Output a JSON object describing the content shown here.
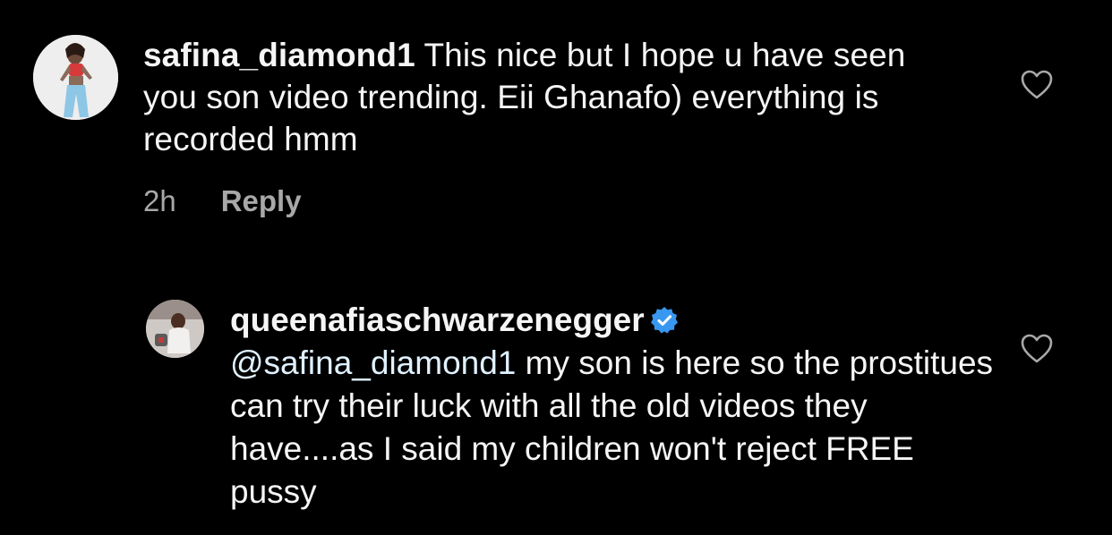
{
  "comments": [
    {
      "username": "safina_diamond1",
      "text": "This nice but I hope u have seen you son video trending. Eii Ghanafo) everything is recorded hmm",
      "time": "2h",
      "reply_label": "Reply",
      "avatar_icon": "profile-photo",
      "like_icon": "heart-outline-icon"
    },
    {
      "username": "queenafiaschwarzenegger",
      "verified": true,
      "mention": "@safina_diamond1",
      "text": "my son is here so the prostitues can try their luck with all the old videos they have....as I said my children won't reject FREE pussy",
      "avatar_icon": "profile-photo",
      "like_icon": "heart-outline-icon"
    }
  ],
  "colors": {
    "background": "#000000",
    "text": "#f5f5f5",
    "meta": "#a8a8a8",
    "mention": "#e0f1ff",
    "verified": "#3897f0"
  }
}
